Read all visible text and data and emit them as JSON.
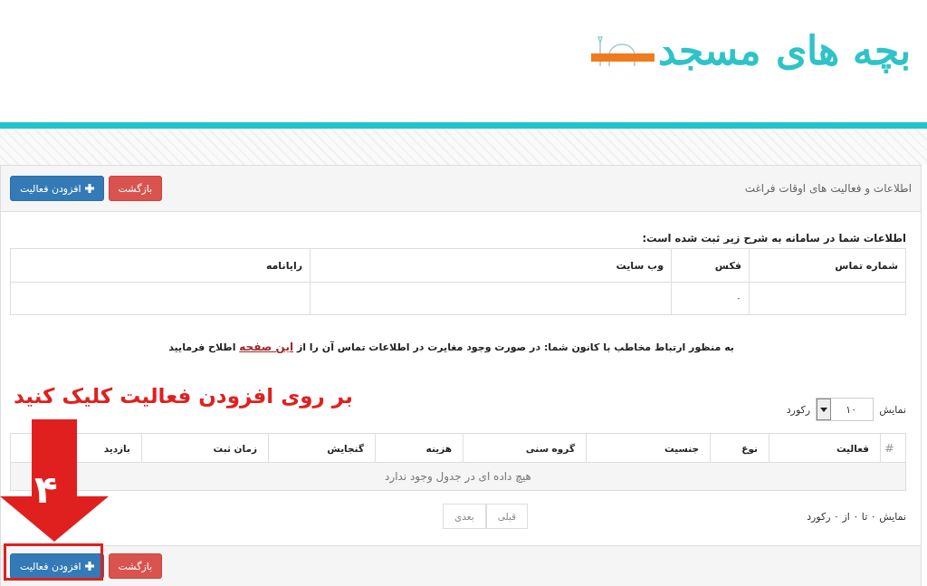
{
  "logo": {
    "title": "بچه های مسجد"
  },
  "panel": {
    "title": "اطلاعات و فعالیت های اوقات فراغت",
    "buttons": [
      {
        "label": "بازگشت",
        "kind": "danger"
      },
      {
        "label": "افزودن فعالیت",
        "kind": "primary"
      }
    ]
  },
  "info_heading": "اطلاعات شما در سامانه به شرح زیر ثبت شده است:",
  "contact_table": {
    "columns": [
      {
        "label": "شماره تماس"
      },
      {
        "label": "فکس",
        "value": "۰"
      },
      {
        "label": "وب سایت"
      },
      {
        "label": "رایانامه"
      }
    ]
  },
  "notice": {
    "before": "به منظور ارتباط مخاطب با کانون شما: در صورت وجود مغایرت در اطلاعات تماس آن را از",
    "link": "این صفحه",
    "after": "اطلاح فرمایید"
  },
  "length_menu": {
    "label_before": "نمایش",
    "value": "۱۰",
    "label_after": "رکورد"
  },
  "activities_table": {
    "columns": [
      "#",
      "فعالیت",
      "نوع",
      "جنسیت",
      "گروه سنی",
      "هزینه",
      "گنجایش",
      "زمان ثبت",
      "بازدید"
    ],
    "empty_message": "هیچ داده ای در جدول وجود ندارد"
  },
  "table_info": "نمایش ۰ تا ۰ از ۰ رکورد",
  "pagination": [
    "قبلی",
    "بعدی"
  ],
  "footer_buttons": [
    {
      "label": "بازگشت",
      "kind": "danger"
    },
    {
      "label": "افزودن فعالیت",
      "kind": "primary"
    }
  ],
  "annotation": {
    "instruction": "بر روی افزودن فعالیت کلیک کنید",
    "step": "۴"
  }
}
